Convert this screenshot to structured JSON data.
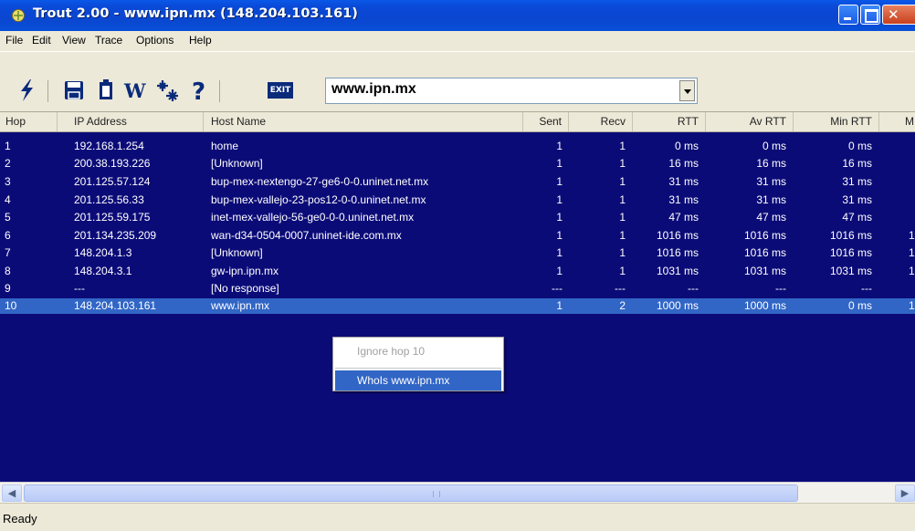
{
  "window": {
    "title": "Trout 2.00 - www.ipn.mx (148.204.103.161)"
  },
  "menu": [
    "File",
    "Edit",
    "View",
    "Trace",
    "Options",
    "Help"
  ],
  "toolbar": {
    "icons": [
      "lightning-icon",
      "save-icon",
      "clipboard-icon",
      "whois-icon",
      "settings-icon",
      "help-icon",
      "exit-icon"
    ],
    "exit_label": "EXIT",
    "target_value": "www.ipn.mx"
  },
  "columns": [
    "Hop",
    "IP Address",
    "Host Name",
    "Sent",
    "Recv",
    "RTT",
    "Av RTT",
    "Min RTT",
    "M"
  ],
  "rows": [
    {
      "hop": "1",
      "ip": "192.168.1.254",
      "host": "home",
      "sent": "1",
      "recv": "1",
      "rtt": "0 ms",
      "avrtt": "0 ms",
      "minrtt": "0 ms",
      "m": ""
    },
    {
      "hop": "2",
      "ip": "200.38.193.226",
      "host": "[Unknown]",
      "sent": "1",
      "recv": "1",
      "rtt": "16 ms",
      "avrtt": "16 ms",
      "minrtt": "16 ms",
      "m": ""
    },
    {
      "hop": "3",
      "ip": "201.125.57.124",
      "host": "bup-mex-nextengo-27-ge6-0-0.uninet.net.mx",
      "sent": "1",
      "recv": "1",
      "rtt": "31 ms",
      "avrtt": "31 ms",
      "minrtt": "31 ms",
      "m": ""
    },
    {
      "hop": "4",
      "ip": "201.125.56.33",
      "host": "bup-mex-vallejo-23-pos12-0-0.uninet.net.mx",
      "sent": "1",
      "recv": "1",
      "rtt": "31 ms",
      "avrtt": "31 ms",
      "minrtt": "31 ms",
      "m": ""
    },
    {
      "hop": "5",
      "ip": "201.125.59.175",
      "host": "inet-mex-vallejo-56-ge0-0-0.uninet.net.mx",
      "sent": "1",
      "recv": "1",
      "rtt": "47 ms",
      "avrtt": "47 ms",
      "minrtt": "47 ms",
      "m": ""
    },
    {
      "hop": "6",
      "ip": "201.134.235.209",
      "host": "wan-d34-0504-0007.uninet-ide.com.mx",
      "sent": "1",
      "recv": "1",
      "rtt": "1016 ms",
      "avrtt": "1016 ms",
      "minrtt": "1016 ms",
      "m": "1"
    },
    {
      "hop": "7",
      "ip": "148.204.1.3",
      "host": "[Unknown]",
      "sent": "1",
      "recv": "1",
      "rtt": "1016 ms",
      "avrtt": "1016 ms",
      "minrtt": "1016 ms",
      "m": "1"
    },
    {
      "hop": "8",
      "ip": "148.204.3.1",
      "host": "gw-ipn.ipn.mx",
      "sent": "1",
      "recv": "1",
      "rtt": "1031 ms",
      "avrtt": "1031 ms",
      "minrtt": "1031 ms",
      "m": "1"
    },
    {
      "hop": "9",
      "ip": "---",
      "host": "[No response]",
      "sent": "---",
      "recv": "---",
      "rtt": "---",
      "avrtt": "---",
      "minrtt": "---",
      "m": ""
    },
    {
      "hop": "10",
      "ip": "148.204.103.161",
      "host": "www.ipn.mx",
      "sent": "1",
      "recv": "2",
      "rtt": "1000 ms",
      "avrtt": "1000 ms",
      "minrtt": "0 ms",
      "m": "1"
    }
  ],
  "context_menu": {
    "ignore_label": "Ignore hop 10",
    "whois_label": "WhoIs www.ipn.mx"
  },
  "status": {
    "text": "Ready"
  }
}
